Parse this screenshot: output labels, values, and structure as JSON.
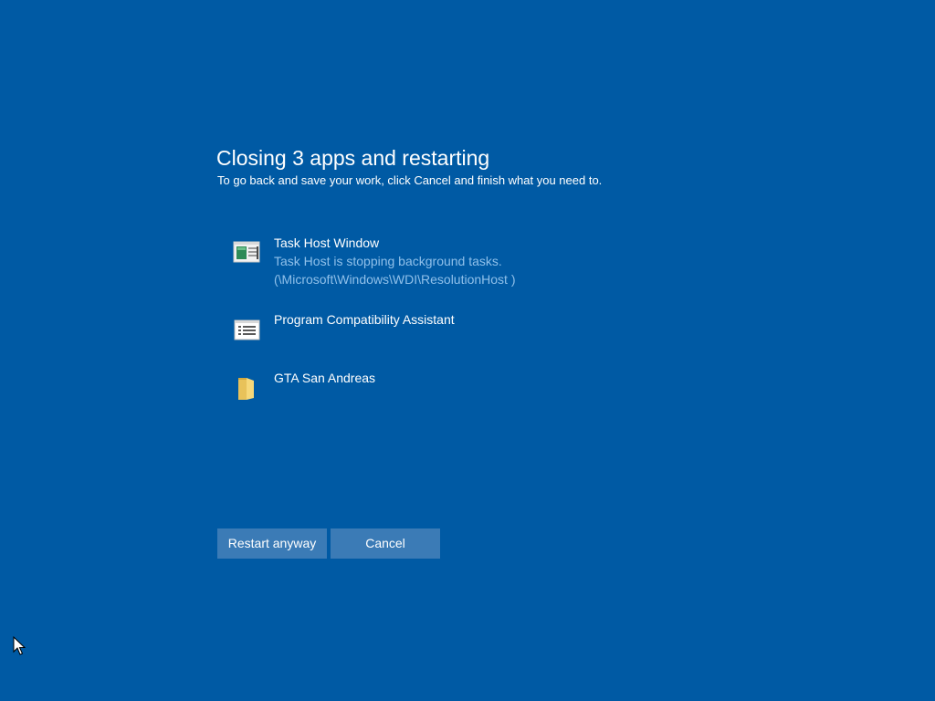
{
  "dialog": {
    "title": "Closing 3 apps and restarting",
    "subtitle": "To go back and save your work, click Cancel and finish what you need to."
  },
  "apps": [
    {
      "name": "Task Host Window",
      "description": "Task Host is stopping background tasks. (\\Microsoft\\Windows\\WDI\\ResolutionHost )",
      "icon": "task-host-window-icon"
    },
    {
      "name": "Program Compatibility Assistant",
      "description": "",
      "icon": "list-window-icon"
    },
    {
      "name": "GTA San Andreas",
      "description": "",
      "icon": "folder-icon"
    }
  ],
  "buttons": {
    "restart_label": "Restart anyway",
    "cancel_label": "Cancel"
  },
  "colors": {
    "background": "#005aa4",
    "button": "#3b7bb6",
    "description_text": "#8fc0ea"
  }
}
